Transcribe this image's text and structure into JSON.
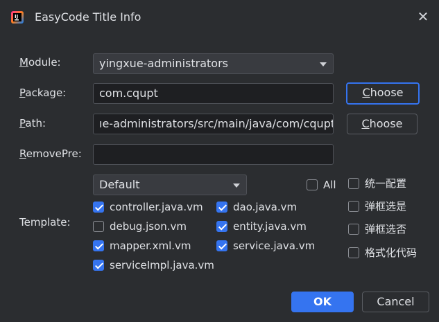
{
  "window": {
    "title": "EasyCode Title Info",
    "icon": "easycode-app-icon",
    "close_icon": "close-icon"
  },
  "form": {
    "module": {
      "label_mnemonic": "M",
      "label_rest": "odule:",
      "value": "yingxue-administrators"
    },
    "package": {
      "label_mnemonic": "P",
      "label_rest": "ackage:",
      "value": "com.cqupt",
      "button": "Choose",
      "button_mnemonic": "C",
      "button_rest": "hoose"
    },
    "path": {
      "label_mnemonic": "P",
      "label_rest": "ath:",
      "value": "ıe-administrators/src/main/java/com/cqupt",
      "button_mnemonic": "C",
      "button_rest": "hoose"
    },
    "remove_pre": {
      "label_mnemonic": "R",
      "label_rest": "emovePre:",
      "value": ""
    },
    "template": {
      "label": "Template:",
      "group_value": "Default",
      "all_label": "All",
      "all_checked": false,
      "items": [
        {
          "label": "controller.java.vm",
          "checked": true
        },
        {
          "label": "dao.java.vm",
          "checked": true
        },
        {
          "label": "debug.json.vm",
          "checked": false
        },
        {
          "label": "entity.java.vm",
          "checked": true
        },
        {
          "label": "mapper.xml.vm",
          "checked": true
        },
        {
          "label": "service.java.vm",
          "checked": true
        },
        {
          "label": "serviceImpl.java.vm",
          "checked": true
        }
      ]
    },
    "options": [
      {
        "label": "统一配置",
        "checked": false
      },
      {
        "label": "弹框选是",
        "checked": false
      },
      {
        "label": "弹框选否",
        "checked": false
      },
      {
        "label": "格式化代码",
        "checked": false
      }
    ]
  },
  "footer": {
    "ok": "OK",
    "cancel": "Cancel"
  },
  "colors": {
    "background": "#2b2d30",
    "accent": "#3574f0",
    "field_bg": "#1e1f22"
  }
}
